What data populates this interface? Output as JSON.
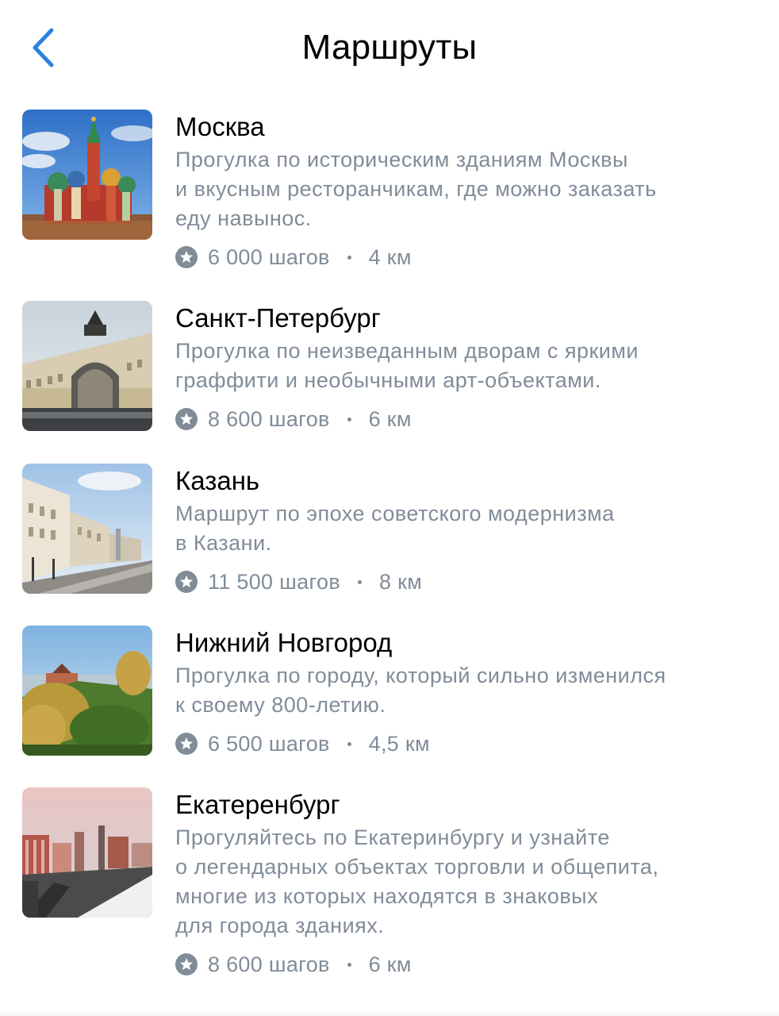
{
  "header": {
    "title": "Маршруты",
    "back_icon": "chevron-left-icon"
  },
  "colors": {
    "accent": "#2d81e0",
    "secondary_text": "#818c99",
    "primary_text": "#000000"
  },
  "routes": [
    {
      "title": "Москва",
      "description_lines": [
        "Прогулка по историческим зданиям Москвы",
        "и вкусным ресторанчикам, где можно заказать",
        "еду навынос."
      ],
      "steps": "6 000 шагов",
      "distance": "4 км",
      "image": "saint-basils-cathedral-photo"
    },
    {
      "title": "Санкт-Петербург",
      "description_lines": [
        "Прогулка по неизведанным дворам с яркими",
        "граффити и необычными арт-объектами."
      ],
      "steps": "8 600 шагов",
      "distance": "6 км",
      "image": "general-staff-building-photo"
    },
    {
      "title": "Казань",
      "description_lines": [
        "Маршрут по эпохе советского модернизма",
        "в Казани."
      ],
      "steps": "11 500 шагов",
      "distance": "8 км",
      "image": "kazan-street-photo"
    },
    {
      "title": "Нижний Новгород",
      "description_lines": [
        "Прогулка по городу, который сильно изменился",
        "к своему 800-летию."
      ],
      "steps": "6 500 шагов",
      "distance": "4,5 км",
      "image": "nizhny-novgorod-kremlin-photo"
    },
    {
      "title": "Екатеренбург",
      "description_lines": [
        "Прогуляйтесь по Екатеринбургу и узнайте",
        "о легендарных объектах торговли и общепита,",
        "многие из которых находятся в знаковых",
        "для города зданиях."
      ],
      "steps": "8 600 шагов",
      "distance": "6 км",
      "image": "yekaterinburg-skyline-photo"
    }
  ]
}
